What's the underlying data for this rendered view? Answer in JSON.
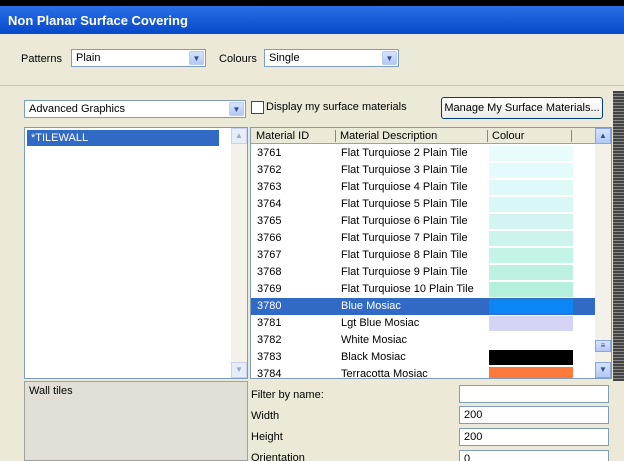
{
  "window": {
    "title": "Non Planar Surface Covering"
  },
  "toolbar": {
    "patterns_label": "Patterns",
    "patterns_value": "Plain",
    "colours_label": "Colours",
    "colours_value": "Single"
  },
  "library": {
    "dropdown_value": "Advanced Graphics",
    "checkbox_label": "Display my surface materials",
    "checkbox_checked": false,
    "manage_button": "Manage My Surface Materials..."
  },
  "surfaces": {
    "items": [
      "*TILEWALL"
    ],
    "selected_index": 0
  },
  "materials": {
    "headers": [
      "Material ID",
      "Material Description",
      "Colour"
    ],
    "rows": [
      {
        "id": "3761",
        "desc": "Flat Turquiose 2 Plain Tile",
        "colour": "#e8fcfc"
      },
      {
        "id": "3762",
        "desc": "Flat Turquiose 3 Plain Tile",
        "colour": "#e4fbfb"
      },
      {
        "id": "3763",
        "desc": "Flat Turquiose 4 Plain Tile",
        "colour": "#def9f8"
      },
      {
        "id": "3764",
        "desc": "Flat Turquiose 5 Plain Tile",
        "colour": "#d8f7f6"
      },
      {
        "id": "3765",
        "desc": "Flat Turquiose 6 Plain Tile",
        "colour": "#d2f5f2"
      },
      {
        "id": "3766",
        "desc": "Flat Turquiose 7 Plain Tile",
        "colour": "#ccf3ee"
      },
      {
        "id": "3767",
        "desc": "Flat Turquiose 8 Plain Tile",
        "colour": "#c4f3e8"
      },
      {
        "id": "3768",
        "desc": "Flat Turquiose 9 Plain Tile",
        "colour": "#bdf2e2"
      },
      {
        "id": "3769",
        "desc": "Flat Turquiose 10 Plain Tile",
        "colour": "#b5f0dc"
      },
      {
        "id": "3780",
        "desc": "Blue Mosiac",
        "colour": "#0a86f5",
        "selected": true
      },
      {
        "id": "3781",
        "desc": "Lgt Blue Mosiac",
        "colour": "#d4d4f4"
      },
      {
        "id": "3782",
        "desc": "White Mosiac",
        "colour": "#ffffff"
      },
      {
        "id": "3783",
        "desc": "Black Mosiac",
        "colour": "#000000"
      },
      {
        "id": "3784",
        "desc": "Terracotta Mosiac",
        "colour": "#ff7a3a"
      }
    ]
  },
  "details": {
    "description": "Wall tiles",
    "filter_label": "Filter by name:",
    "filter_value": "",
    "width_label": "Width",
    "width_value": "200",
    "height_label": "Height",
    "height_value": "200",
    "orientation_label": "Orientation",
    "orientation_value": "0"
  }
}
